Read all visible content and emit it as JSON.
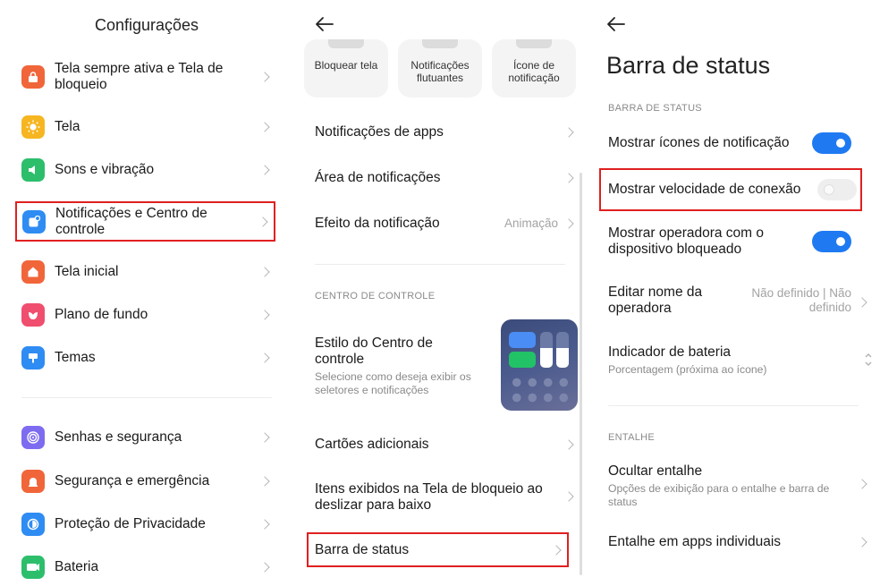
{
  "panel1": {
    "title": "Configurações",
    "items": [
      {
        "label": "Tela sempre ativa e Tela de bloqueio",
        "icon": "lock-icon",
        "color": "#f0663a"
      },
      {
        "label": "Tela",
        "icon": "sun-icon",
        "color": "#f6b622"
      },
      {
        "label": "Sons e vibração",
        "icon": "speaker-icon",
        "color": "#2dbe6c"
      },
      {
        "label": "Notificações e Centro de controle",
        "icon": "notification-icon",
        "color": "#2f8cf2"
      },
      {
        "label": "Tela inicial",
        "icon": "home-icon",
        "color": "#f0663a"
      },
      {
        "label": "Plano de fundo",
        "icon": "flower-icon",
        "color": "#f04e6e"
      },
      {
        "label": "Temas",
        "icon": "brush-icon",
        "color": "#2f8cf2"
      },
      {
        "label": "Senhas e segurança",
        "icon": "fingerprint-icon",
        "color": "#7d6cf0"
      },
      {
        "label": "Segurança e emergência",
        "icon": "emergency-icon",
        "color": "#f0663a"
      },
      {
        "label": "Proteção de Privacidade",
        "icon": "privacy-icon",
        "color": "#2f8cf2"
      },
      {
        "label": "Bateria",
        "icon": "battery-icon",
        "color": "#2dbe6c"
      }
    ]
  },
  "panel2": {
    "tiles": [
      "Bloquear tela",
      "Notificações flutuantes",
      "Ícone de notificação"
    ],
    "rows": {
      "app_notifications": "Notificações de apps",
      "notification_area": "Área de notificações",
      "notification_effect": "Efeito da notificação",
      "notification_effect_value": "Animação",
      "control_center_section": "CENTRO DE CONTROLE",
      "control_center_style": "Estilo do Centro de controle",
      "control_center_style_sub": "Selecione como deseja exibir os seletores e notificações",
      "additional_cards": "Cartões adicionais",
      "lockscreen_items": "Itens exibidos na Tela de bloqueio ao deslizar para baixo",
      "status_bar": "Barra de status"
    }
  },
  "panel3": {
    "title": "Barra de status",
    "section_status": "BARRA DE STATUS",
    "show_notification_icons": "Mostrar ícones de notificação",
    "show_notification_icons_on": true,
    "show_connection_speed": "Mostrar velocidade de conexão",
    "show_connection_speed_on": false,
    "show_carrier_locked": "Mostrar operadora com o dispositivo bloqueado",
    "show_carrier_locked_on": true,
    "edit_carrier_name": "Editar nome da operadora",
    "edit_carrier_name_value": "Não definido | Não definido",
    "battery_indicator": "Indicador de bateria",
    "battery_indicator_sub": "Porcentagem (próxima ao ícone)",
    "section_notch": "ENTALHE",
    "hide_notch": "Ocultar entalhe",
    "hide_notch_sub": "Opções de exibição para o entalhe e barra de status",
    "notch_per_app": "Entalhe em apps individuais"
  },
  "colors": {
    "accent": "#1f7af2",
    "highlight": "#e02020"
  }
}
